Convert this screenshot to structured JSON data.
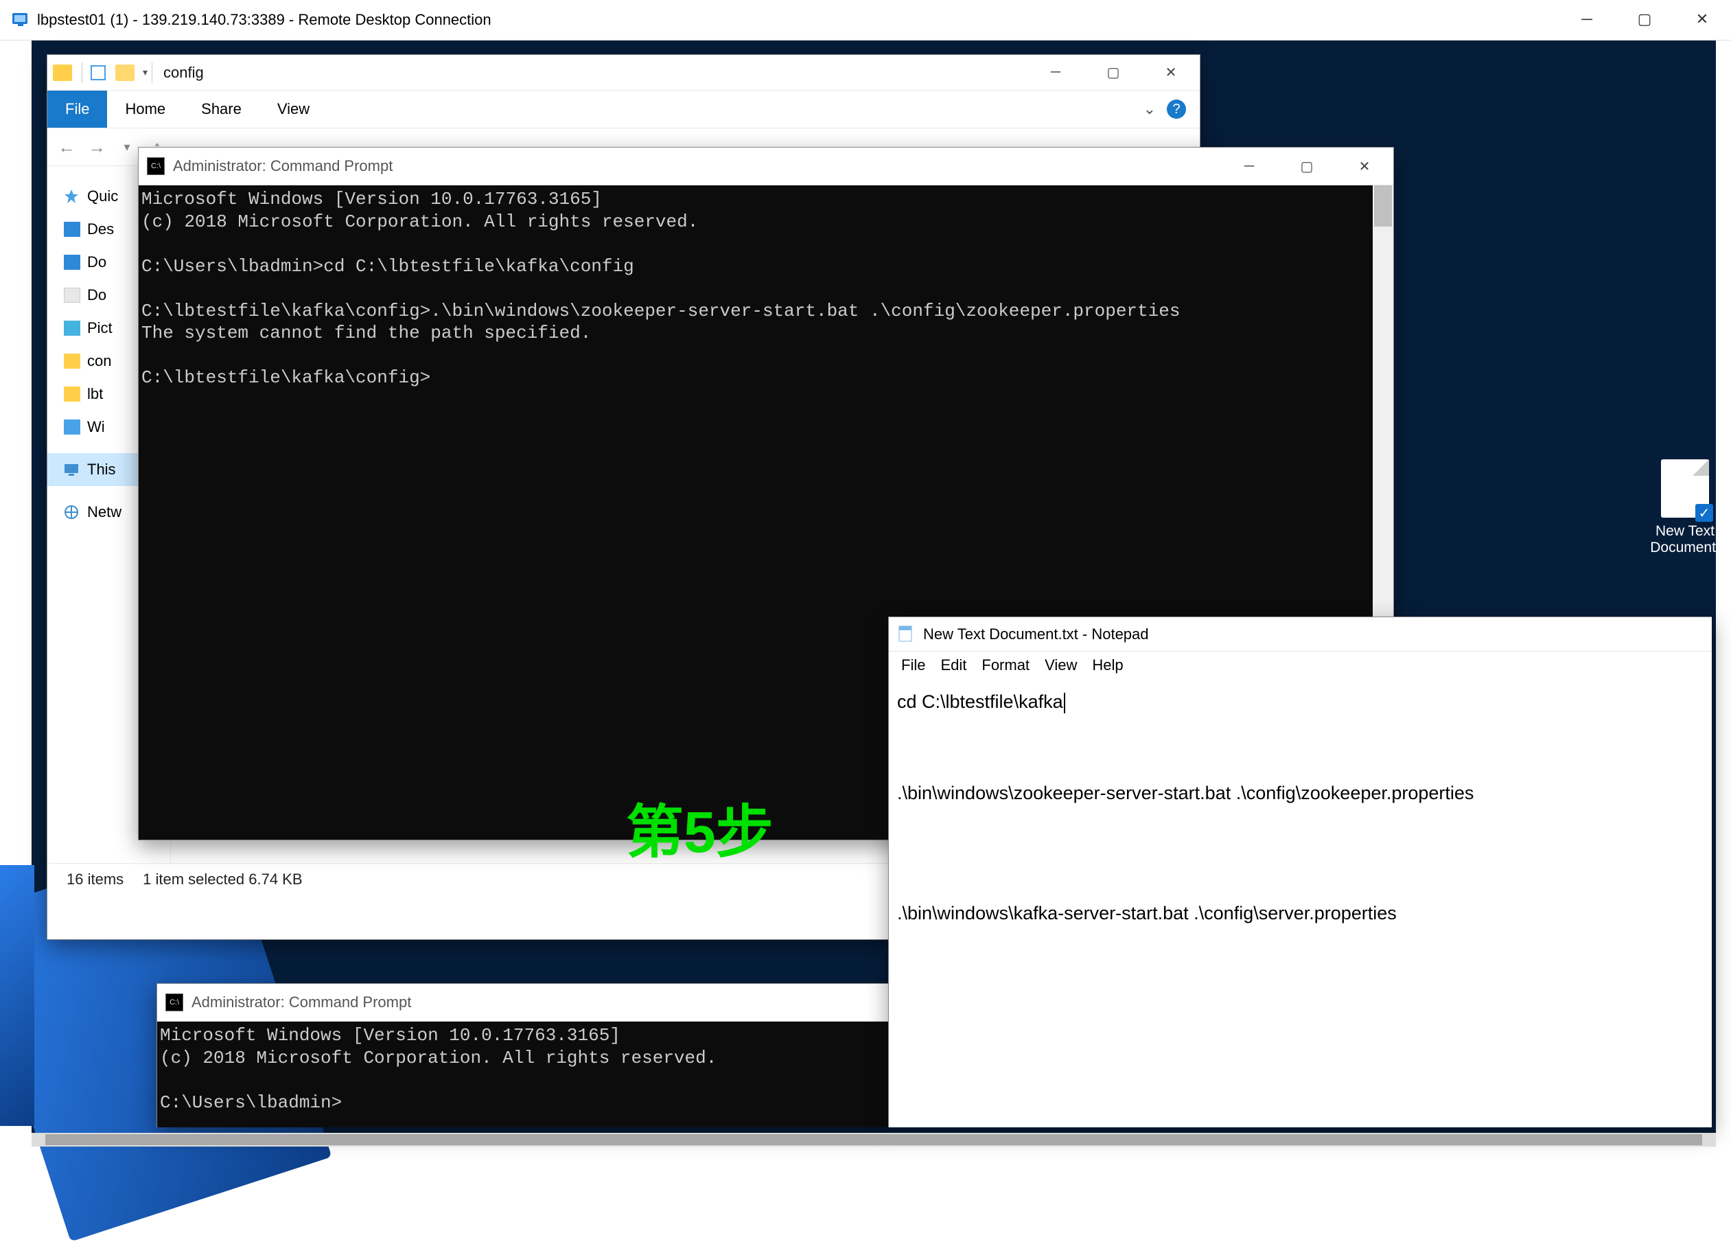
{
  "rdp": {
    "title": "lbpstest01 (1) - 139.219.140.73:3389 - Remote Desktop Connection"
  },
  "desktop": {
    "icon_label_1": "New Text",
    "icon_label_2": "Document."
  },
  "explorer": {
    "crumb": "config",
    "tabs": {
      "file": "File",
      "home": "Home",
      "share": "Share",
      "view": "View"
    },
    "sidebar": {
      "quick": "Quic",
      "desktop": "Des",
      "downloads": "Do",
      "documents": "Do",
      "pictures": "Pict",
      "conf": "con",
      "lbt": "lbt",
      "win": "Wi",
      "thispc": "This",
      "network": "Netw"
    },
    "status": {
      "count": "16 items",
      "selected": "1 item selected  6.74 KB"
    }
  },
  "cmd1": {
    "title": "Administrator: Command Prompt",
    "lines": "Microsoft Windows [Version 10.0.17763.3165]\n(c) 2018 Microsoft Corporation. All rights reserved.\n\nC:\\Users\\lbadmin>cd C:\\lbtestfile\\kafka\\config\n\nC:\\lbtestfile\\kafka\\config>.\\bin\\windows\\zookeeper-server-start.bat .\\config\\zookeeper.properties\nThe system cannot find the path specified.\n\nC:\\lbtestfile\\kafka\\config>"
  },
  "step_label": "第5步",
  "cmd2": {
    "title": "Administrator: Command Prompt",
    "lines": "Microsoft Windows [Version 10.0.17763.3165]\n(c) 2018 Microsoft Corporation. All rights reserved.\n\nC:\\Users\\lbadmin> "
  },
  "notepad": {
    "title": "New Text Document.txt - Notepad",
    "menu": {
      "file": "File",
      "edit": "Edit",
      "format": "Format",
      "view": "View",
      "help": "Help"
    },
    "line1": "cd C:\\lbtestfile\\kafka",
    "line2": ".\\bin\\windows\\zookeeper-server-start.bat .\\config\\zookeeper.properties",
    "line3": ".\\bin\\windows\\kafka-server-start.bat .\\config\\server.properties"
  }
}
